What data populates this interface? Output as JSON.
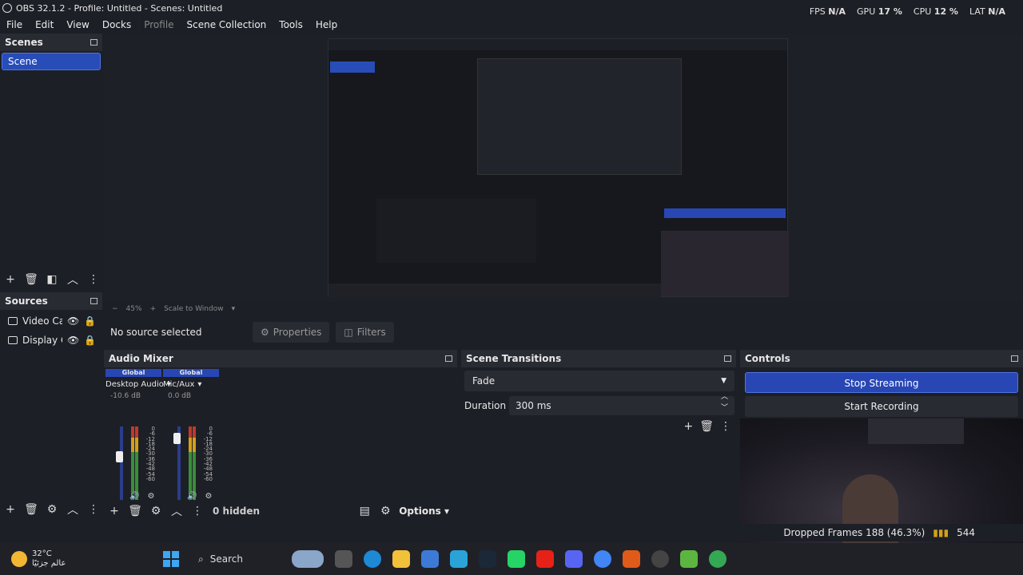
{
  "window": {
    "title": "OBS 32.1.2 - Profile: Untitled - Scenes: Untitled"
  },
  "stats": {
    "fps_label": "FPS",
    "fps_value": "N/A",
    "gpu_label": "GPU",
    "gpu_value": "17 %",
    "cpu_label": "CPU",
    "cpu_value": "12 %",
    "lat_label": "LAT",
    "lat_value": "N/A"
  },
  "menu": {
    "file": "File",
    "edit": "Edit",
    "view": "View",
    "docks": "Docks",
    "profile": "Profile",
    "scene_collection": "Scene Collection",
    "tools": "Tools",
    "help": "Help"
  },
  "scenes": {
    "title": "Scenes",
    "items": [
      "Scene"
    ]
  },
  "sources": {
    "title": "Sources",
    "items": [
      "Video Cap",
      "Display Ca"
    ]
  },
  "preview": {
    "zoom": "45%",
    "scale": "Scale to Window"
  },
  "context": {
    "no_source": "No source selected",
    "properties": "Properties",
    "filters": "Filters"
  },
  "mixer": {
    "title": "Audio Mixer",
    "channels": [
      {
        "global": "Global",
        "name": "Desktop Audio",
        "db": "-10.6 dB",
        "level": 0.6
      },
      {
        "global": "Global",
        "name": "Mic/Aux",
        "db": "0.0 dB",
        "level": 0.9
      }
    ],
    "scale": [
      "0",
      "-6",
      "-12",
      "-18",
      "-24",
      "-30",
      "-36",
      "-42",
      "-48",
      "-54",
      "-60"
    ],
    "hidden": "0 hidden",
    "options": "Options"
  },
  "transitions": {
    "title": "Scene Transitions",
    "selected": "Fade",
    "duration_label": "Duration",
    "duration_value": "300 ms"
  },
  "controls": {
    "title": "Controls",
    "stream": "Stop Streaming",
    "record": "Start Recording"
  },
  "status": {
    "dropped": "Dropped Frames 188 (46.3%)",
    "bitrate": "544"
  },
  "taskbar": {
    "temp": "32°C",
    "weather_text": "عالم جزئيًا",
    "search": "Search"
  },
  "colors": {
    "accent": "#2847b5",
    "bg": "#1d1f26",
    "panel": "#292b33"
  }
}
